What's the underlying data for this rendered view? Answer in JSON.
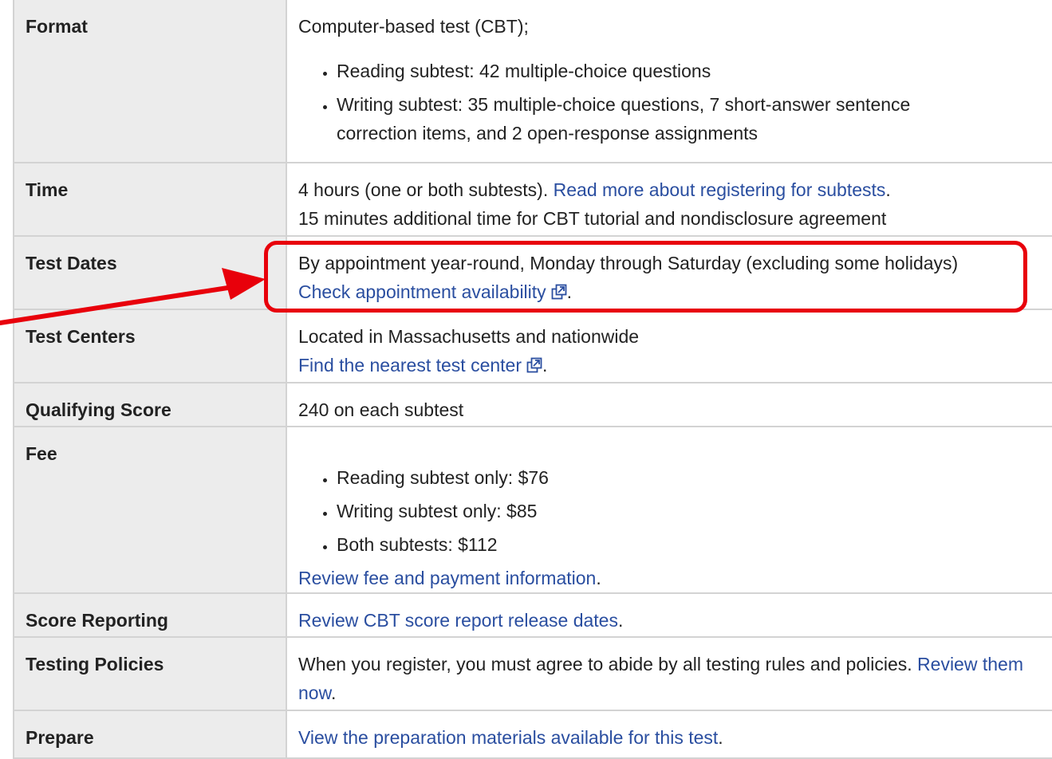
{
  "rows": [
    {
      "label": "Format",
      "intro": "Computer-based test (CBT);",
      "bullets": [
        "Reading subtest: 42 multiple-choice questions",
        "Writing subtest: 35 multiple-choice questions, 7 short-answer sentence correction items, and 2 open-response assignments"
      ]
    },
    {
      "label": "Time",
      "line1_text": "4 hours (one or both subtests). ",
      "line1_link": "Read more about registering for subtests",
      "line2_text": "15 minutes additional time for CBT tutorial and nondisclosure agreement"
    },
    {
      "label": "Test Dates",
      "line1_text": "By appointment year-round, Monday through Saturday (excluding some holidays)",
      "link": "Check appointment availability"
    },
    {
      "label": "Test Centers",
      "line1_text": "Located in Massachusetts and nationwide",
      "link": "Find the nearest test center"
    },
    {
      "label": "Qualifying Score",
      "text": "240 on each subtest"
    },
    {
      "label": "Fee",
      "bullets": [
        "Reading subtest only: $76",
        "Writing subtest only: $85",
        "Both subtests: $112"
      ],
      "link": "Review fee and payment information"
    },
    {
      "label": "Score Reporting",
      "link": "Review CBT score report release dates"
    },
    {
      "label": "Testing Policies",
      "text": "When you register, you must agree to abide by all testing rules and policies. ",
      "link": "Review them now"
    },
    {
      "label": "Prepare",
      "link": "View the preparation materials available for this test"
    }
  ],
  "punct": ".",
  "annotation_color": "#e8000b",
  "link_color": "#2a4ea0",
  "icons": [
    "external-link-icon"
  ]
}
